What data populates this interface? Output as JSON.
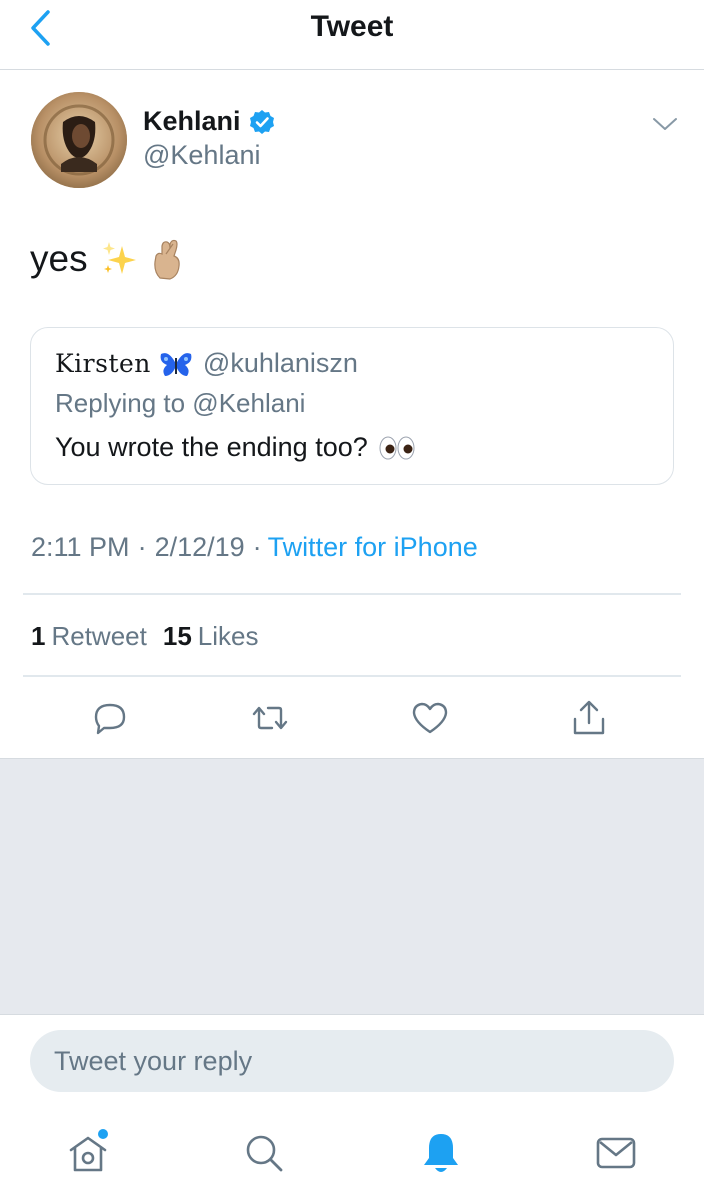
{
  "header": {
    "title": "Tweet",
    "back_icon": "chevron-left-icon"
  },
  "tweet": {
    "author": {
      "name": "Kehlani",
      "handle": "@Kehlani",
      "verified": true
    },
    "text": "yes",
    "emojis": [
      "sparkles",
      "crossed-fingers"
    ],
    "quoted": {
      "name": "Kirsten",
      "name_emoji": "butterfly",
      "handle": "@kuhlaniszn",
      "reply_context": "Replying to @Kehlani",
      "text": "You wrote the ending too?",
      "text_emoji": "eyes"
    },
    "time": "2:11 PM",
    "date": "2/12/19",
    "separator": "·",
    "source": "Twitter for iPhone",
    "retweets": {
      "count": "1",
      "label": "Retweet"
    },
    "likes": {
      "count": "15",
      "label": "Likes"
    },
    "actions": [
      "reply-icon",
      "retweet-icon",
      "like-icon",
      "share-icon"
    ]
  },
  "reply": {
    "placeholder": "Tweet your reply"
  },
  "tabs": [
    "home-icon",
    "search-icon",
    "notifications-icon",
    "messages-icon"
  ],
  "colors": {
    "accent": "#1da1f2",
    "secondary_text": "#657786",
    "background_grey": "#e6e9ee"
  }
}
